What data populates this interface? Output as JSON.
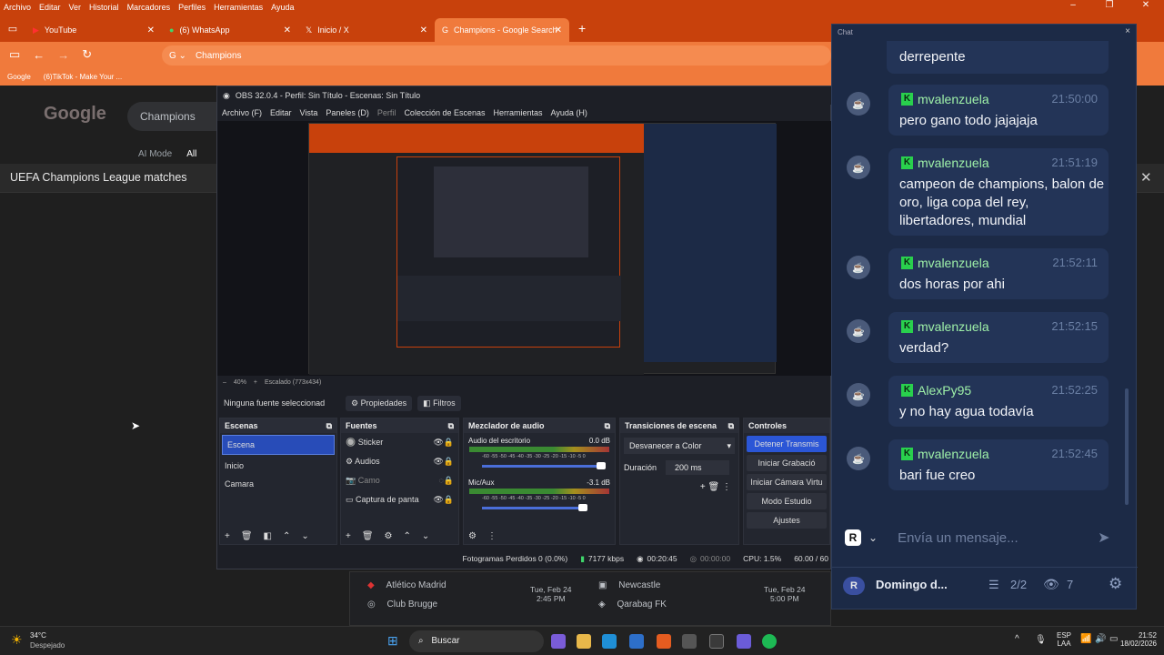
{
  "browser": {
    "menu": [
      "Archivo",
      "Editar",
      "Ver",
      "Historial",
      "Marcadores",
      "Perfiles",
      "Herramientas",
      "Ayuda"
    ],
    "tabs": [
      {
        "label": "YouTube",
        "icon": "youtube-icon"
      },
      {
        "label": "(6) WhatsApp",
        "icon": "whatsapp-icon"
      },
      {
        "label": "Inicio / X",
        "icon": "x-icon"
      },
      {
        "label": "Champions - Google Search",
        "icon": "google-icon",
        "active": true
      }
    ],
    "address": "Champions",
    "bookmarks": [
      "Google",
      "(6)TikTok - Make Your ..."
    ]
  },
  "google": {
    "logo": "Google",
    "query": "Champions",
    "tabs": [
      "AI Mode",
      "All"
    ],
    "ucl_title": "UEFA Champions League matches",
    "matches": [
      {
        "team1": "Atlético Madrid",
        "team2": "Club Brugge",
        "date": "Tue, Feb 24",
        "time": "2:45 PM"
      },
      {
        "team1": "Newcastle",
        "team2": "Qarabag FK",
        "date": "Tue, Feb 24",
        "time": "5:00 PM"
      }
    ]
  },
  "obs": {
    "title": "OBS 32.0.4 - Perfil: Sin Título - Escenas: Sin Título",
    "menu": [
      "Archivo (F)",
      "Editar",
      "Vista",
      "Paneles (D)",
      "Perfil",
      "Colección de Escenas",
      "Herramientas",
      "Ayuda (H)"
    ],
    "zoom": "40%",
    "scaling": "Escalado (773x434)",
    "no_source": "Ninguna fuente seleccionad",
    "properties": "Propiedades",
    "filters": "Filtros",
    "scenes": {
      "title": "Escenas",
      "items": [
        "Escena",
        "Inicio",
        "Camara"
      ]
    },
    "sources": {
      "title": "Fuentes",
      "items": [
        "Sticker",
        "Audios",
        "Camo",
        "Captura de panta"
      ]
    },
    "mixer": {
      "title": "Mezclador de audio",
      "channels": [
        {
          "name": "Audio del escritorio",
          "db": "0.0 dB"
        },
        {
          "name": "Mic/Aux",
          "db": "-3.1 dB"
        }
      ],
      "ticks": "-60 -55 -50 -45 -40 -35 -30 -25 -20 -15 -10 -5 0"
    },
    "transitions": {
      "title": "Transiciones de escena",
      "selected": "Desvanecer a Color",
      "duration_label": "Duración",
      "duration": "200 ms"
    },
    "controls": {
      "title": "Controles",
      "buttons": [
        "Detener Transmis",
        "Iniciar Grabació",
        "Iniciar Cámara Virtu",
        "Modo Estudio",
        "Ajustes"
      ]
    },
    "status": {
      "dropped": "Fotogramas Perdidos 0 (0.0%)",
      "kbps": "7177 kbps",
      "live": "00:20:45",
      "rec": "00:00:00",
      "cpu": "CPU: 1.5%",
      "fps": "60.00 / 60"
    }
  },
  "chat": {
    "header": "Chat",
    "partial": "derrepente",
    "messages": [
      {
        "user": "mvalenzuela",
        "time": "21:50:00",
        "text": "pero gano todo jajajaja"
      },
      {
        "user": "mvalenzuela",
        "time": "21:51:19",
        "text": "campeon de champions, balon de oro, liga copa del rey, libertadores, mundial"
      },
      {
        "user": "mvalenzuela",
        "time": "21:52:11",
        "text": "dos horas por ahi"
      },
      {
        "user": "mvalenzuela",
        "time": "21:52:15",
        "text": "verdad?"
      },
      {
        "user": "AlexPy95",
        "time": "21:52:25",
        "text": "y no hay agua todavía"
      },
      {
        "user": "mvalenzuela",
        "time": "21:52:45",
        "text": "bari fue creo"
      }
    ],
    "input_placeholder": "Envía un mensaje...",
    "channel": "Domingo d...",
    "mods": "2/2",
    "viewers": "7"
  },
  "taskbar": {
    "temp": "34°C",
    "weather": "Despejado",
    "search": "Buscar",
    "lang1": "ESP",
    "lang2": "LAA",
    "time": "21:52",
    "date": "18/02/2026"
  },
  "colors": {
    "accent": "#f07a3c",
    "chat_bg": "#1c2a46",
    "kick_green": "#29d04d"
  }
}
